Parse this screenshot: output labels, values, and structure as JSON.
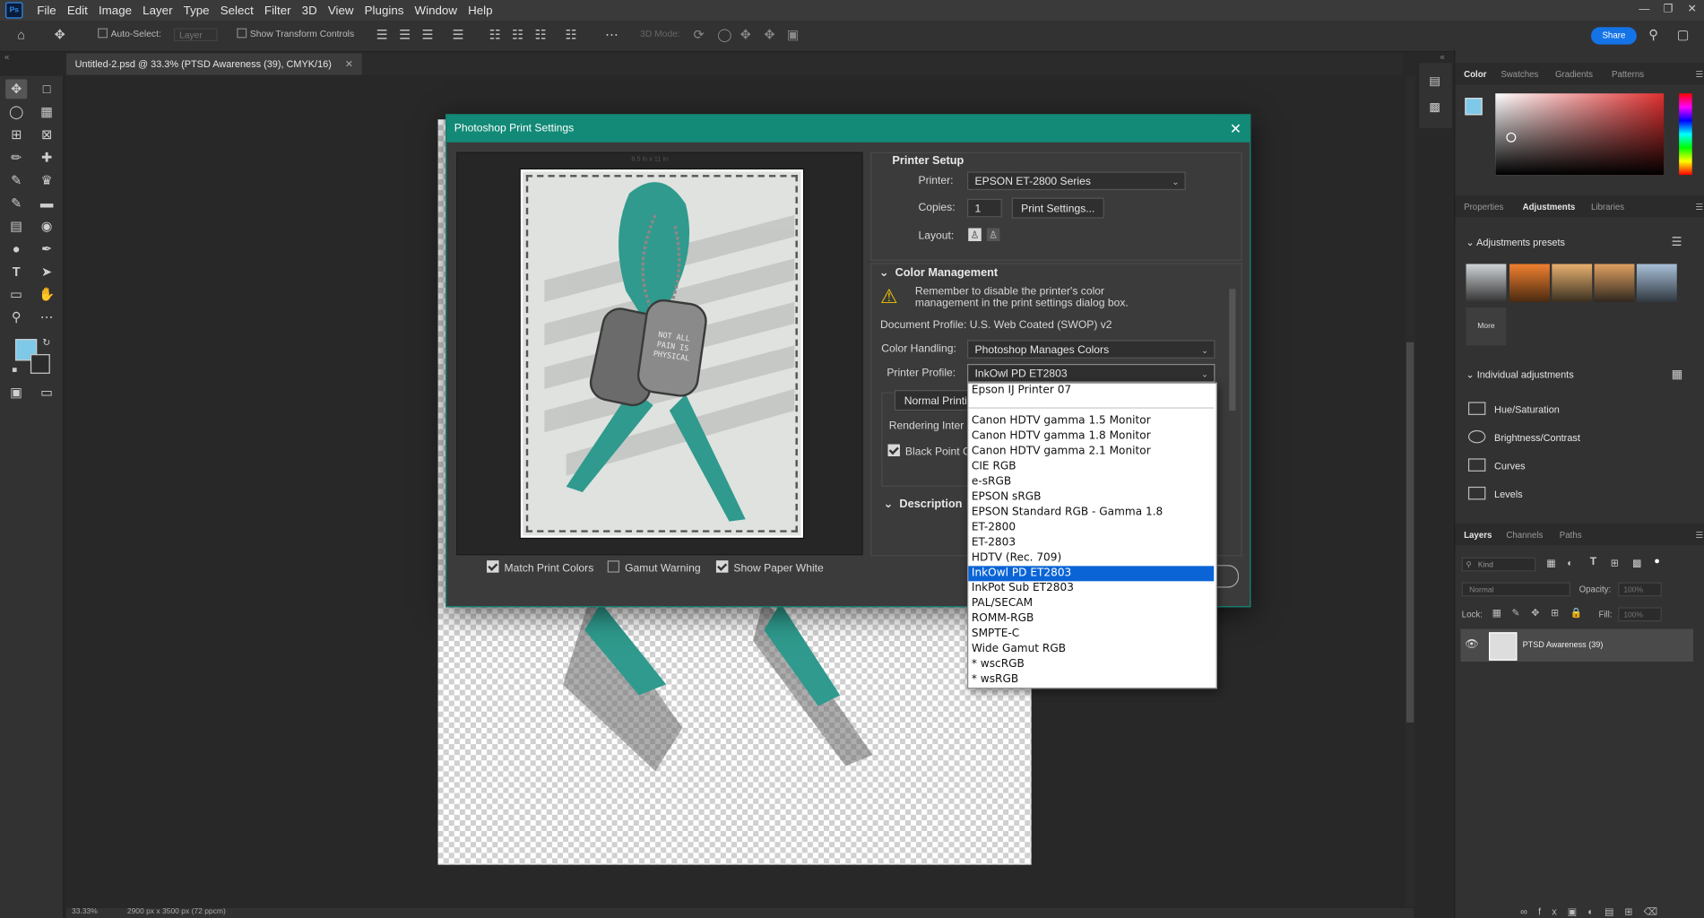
{
  "menu": {
    "logo": "Ps",
    "items": [
      "File",
      "Edit",
      "Image",
      "Layer",
      "Type",
      "Select",
      "Filter",
      "3D",
      "View",
      "Plugins",
      "Window",
      "Help"
    ]
  },
  "options_bar": {
    "auto_select": "Auto-Select:",
    "layer_select": "Layer",
    "show_transform": "Show Transform Controls",
    "mode_3d": "3D Mode:",
    "share": "Share"
  },
  "document": {
    "tab_title": "Untitled-2.psd @ 33.3% (PTSD Awareness (39), CMYK/16)",
    "zoom": "33.33%",
    "dimensions": "2900 px x 3500 px (72 ppcm)"
  },
  "dialog": {
    "title": "Photoshop Print Settings",
    "paper_label": "8.5 in x 11 in",
    "tag_text": "NOT ALL PAIN IS PHYSICAL",
    "printer_setup": {
      "heading": "Printer Setup",
      "printer_label": "Printer:",
      "printer_value": "EPSON ET-2800 Series",
      "copies_label": "Copies:",
      "copies_value": "1",
      "print_settings_button": "Print Settings...",
      "layout_label": "Layout:"
    },
    "color_management": {
      "heading": "Color Management",
      "warning": "Remember to disable the printer's color management in the print settings dialog box.",
      "document_profile": "Document Profile: U.S. Web Coated (SWOP) v2",
      "color_handling_label": "Color Handling:",
      "color_handling_value": "Photoshop Manages Colors",
      "printer_profile_label": "Printer Profile:",
      "printer_profile_value": "InkOwl PD ET2803",
      "normal_printing": "Normal Printi",
      "rendering_intent": "Rendering Inter",
      "black_point": "Black Point C"
    },
    "description_heading": "Description",
    "bottom_checks": [
      {
        "label": "Match Print Colors",
        "checked": true
      },
      {
        "label": "Gamut Warning",
        "checked": false
      },
      {
        "label": "Show Paper White",
        "checked": true
      }
    ]
  },
  "profile_dropdown": {
    "items": [
      "Epson IJ Printer 07",
      "",
      "Canon HDTV gamma 1.5 Monitor",
      "Canon HDTV gamma 1.8 Monitor",
      "Canon HDTV gamma 2.1 Monitor",
      "CIE RGB",
      "e-sRGB",
      "EPSON  sRGB",
      "EPSON  Standard RGB - Gamma 1.8",
      "ET-2800",
      "ET-2803",
      "HDTV (Rec. 709)",
      "InkOwl PD ET2803",
      "InkPot Sub ET2803",
      "PAL/SECAM",
      "ROMM-RGB",
      "SMPTE-C",
      "Wide Gamut RGB",
      "* wscRGB",
      "* wsRGB"
    ],
    "selected": "InkOwl PD ET2803"
  },
  "right_panel": {
    "color_tabs": [
      "Color",
      "Swatches",
      "Gradients",
      "Patterns"
    ],
    "adjust_tabs": [
      "Properties",
      "Adjustments",
      "Libraries"
    ],
    "adjustments_presets": "Adjustments presets",
    "more": "More",
    "individual_adjustments": "Individual adjustments",
    "adjustments": [
      "Hue/Saturation",
      "Brightness/Contrast",
      "Curves",
      "Levels"
    ],
    "layer_tabs": [
      "Layers",
      "Channels",
      "Paths"
    ],
    "kind": "Kind",
    "blend_mode": "Normal",
    "opacity_label": "Opacity:",
    "opacity_value": "100%",
    "lock_label": "Lock:",
    "fill_label": "Fill:",
    "fill_value": "100%",
    "layer_name": "PTSD Awareness (39)"
  },
  "colors": {
    "accent": "#128a77",
    "selection": "#0a64d6",
    "share": "#1473e6",
    "ribbon": "#2f9a8d"
  }
}
